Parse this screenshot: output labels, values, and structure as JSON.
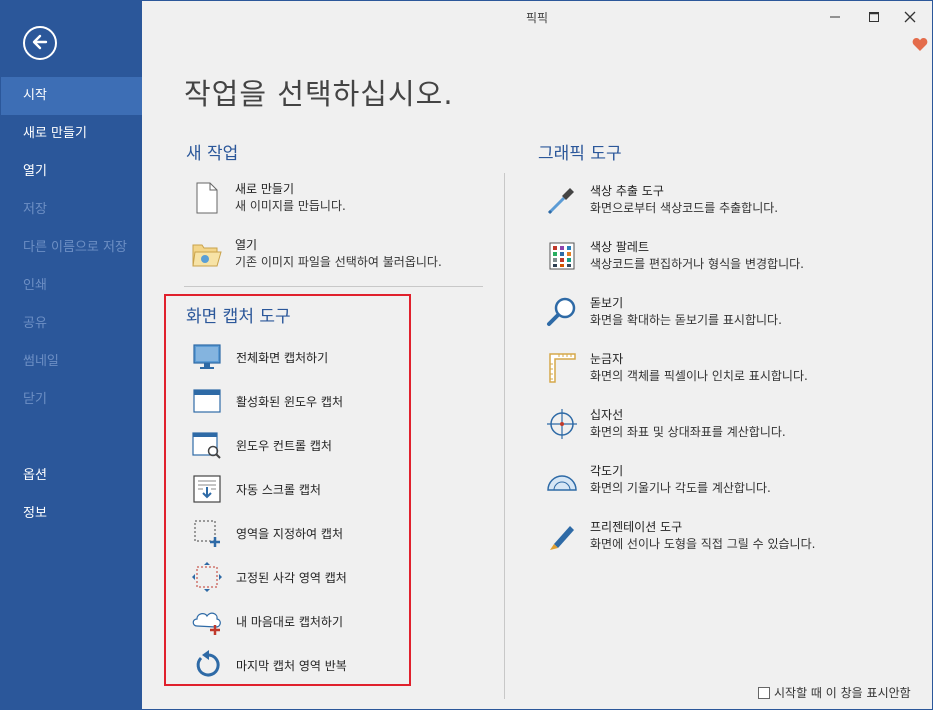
{
  "window": {
    "title": "픽픽"
  },
  "sidebar": {
    "items": [
      {
        "label": "시작"
      },
      {
        "label": "새로 만들기"
      },
      {
        "label": "열기"
      },
      {
        "label": "저장"
      },
      {
        "label": "다른 이름으로 저장"
      },
      {
        "label": "인쇄"
      },
      {
        "label": "공유"
      },
      {
        "label": "썸네일"
      },
      {
        "label": "닫기"
      }
    ],
    "bottom": [
      {
        "label": "옵션"
      },
      {
        "label": "정보"
      }
    ]
  },
  "main": {
    "title": "작업을 선택하십시오.",
    "new_task": {
      "heading": "새 작업",
      "items": [
        {
          "title": "새로 만들기",
          "desc": "새 이미지를 만듭니다."
        },
        {
          "title": "열기",
          "desc": "기존 이미지 파일을 선택하여 불러옵니다."
        }
      ]
    },
    "capture": {
      "heading": "화면 캡처 도구",
      "items": [
        {
          "label": "전체화면 캡처하기"
        },
        {
          "label": "활성화된 윈도우 캡처"
        },
        {
          "label": "윈도우 컨트롤 캡처"
        },
        {
          "label": "자동 스크롤 캡처"
        },
        {
          "label": "영역을 지정하여 캡처"
        },
        {
          "label": "고정된 사각 영역 캡처"
        },
        {
          "label": "내 마음대로 캡처하기"
        },
        {
          "label": "마지막 캡처 영역 반복"
        }
      ]
    },
    "graphics": {
      "heading": "그래픽 도구",
      "items": [
        {
          "title": "색상 추출 도구",
          "desc": "화면으로부터 색상코드를 추출합니다."
        },
        {
          "title": "색상 팔레트",
          "desc": "색상코드를 편집하거나 형식을 변경합니다."
        },
        {
          "title": "돋보기",
          "desc": "화면을 확대하는 돋보기를 표시합니다."
        },
        {
          "title": "눈금자",
          "desc": "화면의 객체를 픽셀이나 인치로 표시합니다."
        },
        {
          "title": "십자선",
          "desc": "화면의 좌표 및 상대좌표를 계산합니다."
        },
        {
          "title": "각도기",
          "desc": "화면의 기울기나 각도를 계산합니다."
        },
        {
          "title": "프리젠테이션 도구",
          "desc": "화면에 선이나 도형을 직접 그릴 수 있습니다."
        }
      ]
    }
  },
  "footer": {
    "startup_checkbox_label": "시작할 때 이 창을 표시안함",
    "checked": false
  },
  "colors": {
    "sidebar": "#2b579a",
    "sidebar_active": "#3d6eb5",
    "accent": "#2b579a",
    "highlight_box": "#e0202c",
    "heart": "#e46c4b"
  }
}
